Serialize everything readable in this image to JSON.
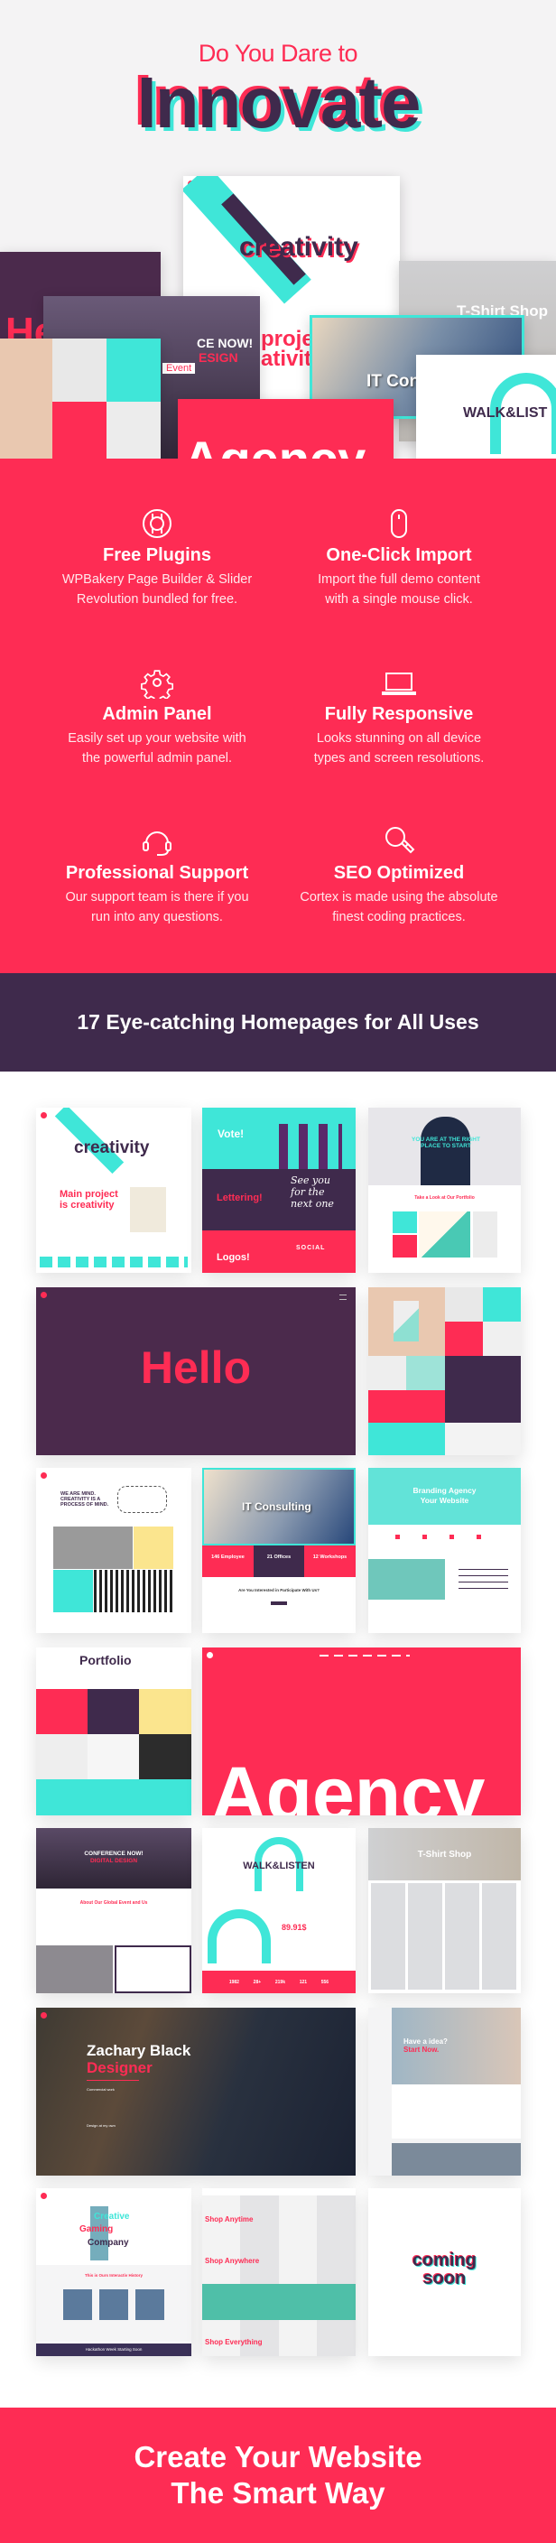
{
  "hero": {
    "kicker": "Do You Dare to",
    "title": "Innovate"
  },
  "collage": {
    "creativity": "creativity",
    "hello": "Hello",
    "conference": "CE NOW!",
    "conference_sub": "ESIGN",
    "project": "projec",
    "project_2": "ativity",
    "tshirt": "T-Shirt Shop",
    "it": "IT Consulting",
    "agency": "Agency",
    "walk": "WALK&LIST",
    "event": "Event"
  },
  "features": [
    {
      "icon": "lifebuoy-icon",
      "title": "Free Plugins",
      "desc1": "WPBakery Page Builder & Slider",
      "desc2": "Revolution bundled for free."
    },
    {
      "icon": "mouse-icon",
      "title": "One-Click Import",
      "desc1": "Import the full demo content",
      "desc2": "with a single mouse click."
    },
    {
      "icon": "gear-icon",
      "title": "Admin Panel",
      "desc1": "Easily set up your website with",
      "desc2": "the powerful admin panel."
    },
    {
      "icon": "laptop-icon",
      "title": "Fully Responsive",
      "desc1": "Looks stunning on all device",
      "desc2": "types and screen resolutions."
    },
    {
      "icon": "headset-icon",
      "title": "Professional Support",
      "desc1": "Our support team is there if you",
      "desc2": "run into any questions."
    },
    {
      "icon": "magnifier-icon",
      "title": "SEO Optimized",
      "desc1": "Cortex is made using the absolute",
      "desc2": "finest coding practices."
    }
  ],
  "band": {
    "title": "17 Eye-catching Homepages for All Uses"
  },
  "gallery": {
    "creativity": {
      "title": "creativity",
      "project": "Main project",
      "project2": "is creativity"
    },
    "lettering": {
      "vote": "Vote!",
      "lettering": "Lettering!",
      "script": "See you for the next one",
      "logos": "Logos!",
      "social": "SOCIAL"
    },
    "start": {
      "headline": "YOU ARE AT THE RIGHT PLACE TO START",
      "portfolio": "Take a Look at Our Portfolio"
    },
    "hello": {
      "title": "Hello"
    },
    "mind": {
      "headline": "WE ARE MIND. CREATIVITY IS A PROCESS OF MIND."
    },
    "it": {
      "title": "IT Consulting",
      "stats": [
        "146 Employee",
        "21 Offices",
        "12 Workshops"
      ],
      "question": "Are You Interested in Participate With Us?"
    },
    "branding": {
      "title1": "Branding Agency",
      "title2": "Your Website"
    },
    "portfolio": {
      "title": "Portfolio"
    },
    "agency": {
      "title": "Agency"
    },
    "conference": {
      "title": "CONFERENCE NOW!",
      "sub": "DIGITAL DESIGN",
      "about": "About Our Global Event and Us"
    },
    "walk": {
      "title": "WALK&LISTEN",
      "price": "89.91$",
      "stats": [
        "1982",
        "28+",
        "219k",
        "121",
        "556"
      ]
    },
    "tshirt": {
      "title": "T-Shirt Shop"
    },
    "zachary": {
      "name": "Zachary Black",
      "role": "Designer",
      "sec1": "Commercial work",
      "sec2": "Design at my own"
    },
    "idea": {
      "line1": "Have a idea?",
      "line2": "Start Now."
    },
    "gaming": {
      "l1": "Creative",
      "l2": "Gaming",
      "l3": "Company",
      "history": "This is Ours Interactiv History",
      "hackathon": "Hackathon Week Starting Soon"
    },
    "shop": {
      "l1": "Shop Anytime",
      "l2": "Shop Anywhere",
      "l3": "Shop Everything"
    },
    "soon": {
      "l1": "coming",
      "l2": "soon"
    }
  },
  "cta": {
    "line1": "Create Your Website",
    "line2": "The Smart Way"
  },
  "colors": {
    "pink": "#fe2c54",
    "purple": "#3f2a4c",
    "teal": "#3fe6d8"
  }
}
